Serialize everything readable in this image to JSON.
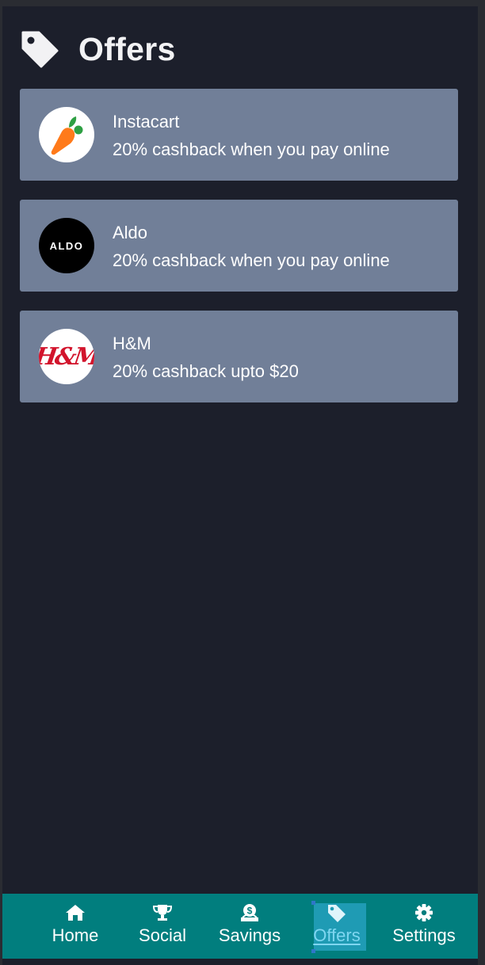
{
  "header": {
    "title": "Offers",
    "icon": "tag-icon"
  },
  "offers": [
    {
      "name": "Instacart",
      "description": "20% cashback when you pay online",
      "logo": "carrot-logo"
    },
    {
      "name": "Aldo",
      "description": "20% cashback when you pay online",
      "logo": "aldo-logo",
      "logo_text": "ALDO"
    },
    {
      "name": "H&M",
      "description": "20% cashback upto $20",
      "logo": "hm-logo",
      "logo_text": "H&M"
    }
  ],
  "tabbar": {
    "tabs": [
      {
        "label": "Home",
        "icon": "home-icon"
      },
      {
        "label": "Social",
        "icon": "trophy-icon"
      },
      {
        "label": "Savings",
        "icon": "money-bag-icon"
      },
      {
        "label": "Offers",
        "icon": "tag-icon",
        "active": true
      },
      {
        "label": "Settings",
        "icon": "gear-icon"
      }
    ]
  },
  "colors": {
    "background": "#1c1f2b",
    "card": "#717f98",
    "tabbar": "#017e7e",
    "active_tab": "#1f9bb4"
  }
}
